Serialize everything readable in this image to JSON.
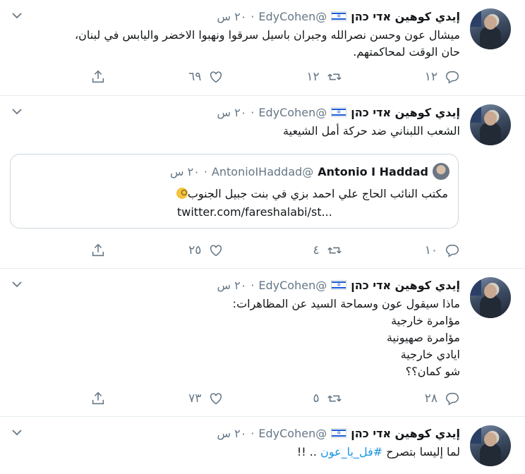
{
  "colors": {
    "accent": "#1b95e0",
    "muted": "#657786",
    "text": "#14171a",
    "border": "#e6ecf0"
  },
  "tweets": [
    {
      "name": "إيدي كوهين אדי כהן",
      "handle": "@EdyCohen",
      "time": "٢٠ س",
      "lines": [
        "ميشال عون وحسن نصرالله وجبران باسيل سرقوا ونهبوا الاخضر واليابس في لبنان،",
        "حان الوقت لمحاكمتهم."
      ],
      "reply_count": "١٢",
      "retweet_count": "١٢",
      "like_count": "٦٩"
    },
    {
      "name": "إيدي كوهين אדי כהן",
      "handle": "@EdyCohen",
      "time": "٢٠ س",
      "lines": [
        "الشعب اللبناني ضد حركة أمل الشيعية"
      ],
      "quote": {
        "name": "Antonio I Haddad",
        "handle": "@AntonioIHaddad",
        "time": "٢٠ س",
        "text": "مكتب النائب الحاج علي احمد بزي في بنت جبيل الجنوب",
        "link": "twitter.com/fareshalabi/st..."
      },
      "reply_count": "١٠",
      "retweet_count": "٤",
      "like_count": "٢٥"
    },
    {
      "name": "إيدي كوهين אדי כהן",
      "handle": "@EdyCohen",
      "time": "٢٠ س",
      "lines": [
        "ماذا سيقول عون وسماحة السيد عن المظاهرات:",
        "مؤامرة خارجية",
        "مؤامرة صهيونية",
        "ايادي خارجية",
        "شو كمان؟؟"
      ],
      "reply_count": "٢٨",
      "retweet_count": "٥",
      "like_count": "٧٣"
    },
    {
      "name": "إيدي كوهين אדי כהן",
      "handle": "@EdyCohen",
      "time": "٢٠ س",
      "text_before": "لما إليسا بتصرح ",
      "hashtag": "#فل_يا_عون",
      "text_after": " .. !!"
    }
  ]
}
